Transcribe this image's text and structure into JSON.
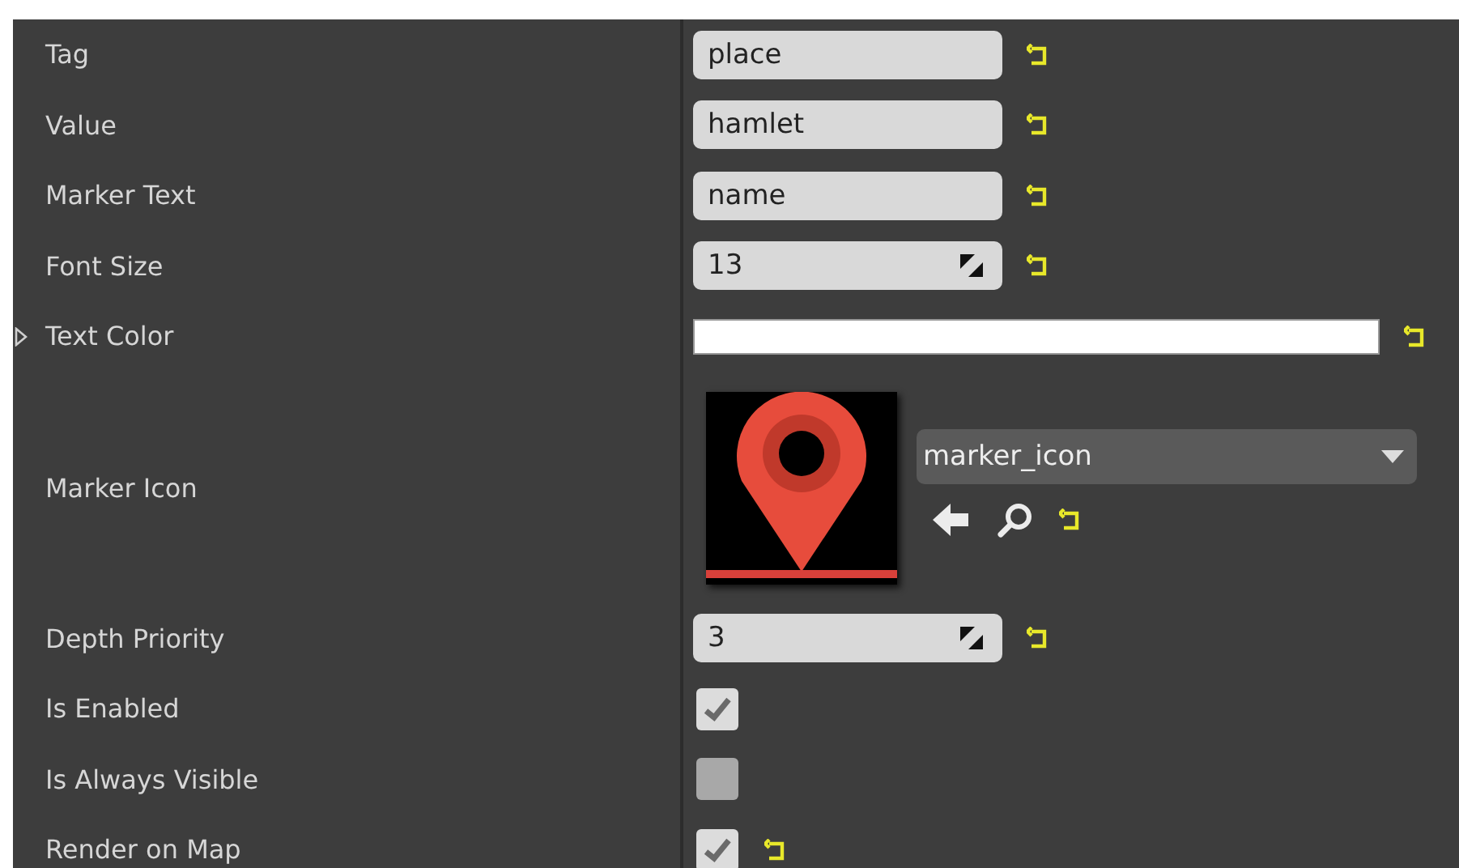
{
  "properties": [
    {
      "label": "Tag",
      "kind": "text",
      "value": "place",
      "modified": true
    },
    {
      "label": "Value",
      "kind": "text",
      "value": "hamlet",
      "modified": true
    },
    {
      "label": "Marker Text",
      "kind": "text",
      "value": "name",
      "modified": true
    },
    {
      "label": "Font Size",
      "kind": "number",
      "value": "13",
      "modified": true
    },
    {
      "label": "Text Color",
      "kind": "color",
      "color": "#ffffff",
      "expanded": false,
      "modified": true
    },
    {
      "label": "Marker Icon",
      "kind": "asset",
      "value": "marker_icon",
      "modified": true
    },
    {
      "label": "Depth Priority",
      "kind": "number",
      "value": "3",
      "modified": true
    },
    {
      "label": "Is Enabled",
      "kind": "checkbox",
      "checked": true,
      "modified": false
    },
    {
      "label": "Is Always Visible",
      "kind": "checkbox",
      "checked": false,
      "modified": false
    },
    {
      "label": "Render on Map",
      "kind": "checkbox",
      "checked": true,
      "modified": true
    }
  ]
}
